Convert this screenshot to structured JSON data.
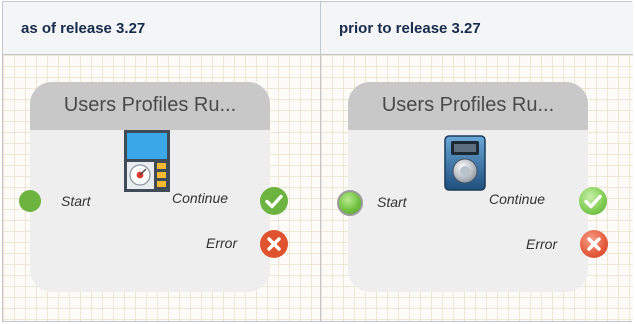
{
  "columns": [
    {
      "header": "as of release 3.27"
    },
    {
      "header": "prior to release 3.27"
    }
  ],
  "node_new": {
    "title": "Users Profiles Ru...",
    "icon": "user-profile-panel-icon",
    "start_label": "Start",
    "continue_label": "Continue",
    "error_label": "Error"
  },
  "node_old": {
    "title": "Users Profiles Ru...",
    "icon": "dial-device-icon",
    "start_label": "Start",
    "continue_label": "Continue",
    "error_label": "Error"
  },
  "colors": {
    "header_bg": "#f4f5f7",
    "node_bg": "#eeeeee",
    "node_title_bar": "#c8c8c8",
    "port_green": "#6db33f",
    "port_red": "#e0532f"
  }
}
